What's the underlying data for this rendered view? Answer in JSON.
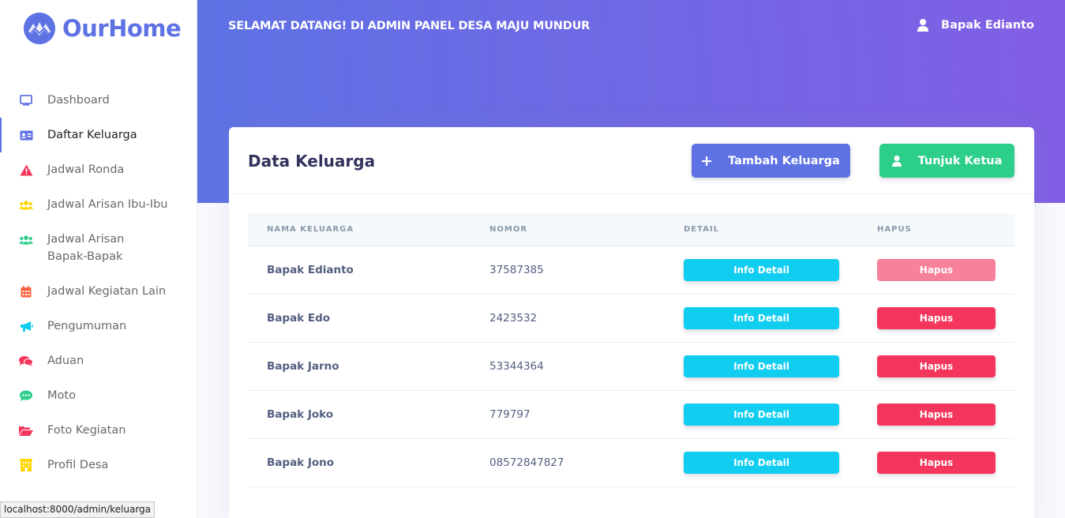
{
  "brand": {
    "name": "OurHome",
    "icon": "home-logo-icon",
    "color": "#5e72e4"
  },
  "sidebar": {
    "items": [
      {
        "label": "Dashboard",
        "icon": "tv-icon",
        "color": "#5e72e4",
        "active": false
      },
      {
        "label": "Daftar Keluarga",
        "icon": "id-card-icon",
        "color": "#5e72e4",
        "active": true
      },
      {
        "label": "Jadwal Ronda",
        "icon": "warning-icon",
        "color": "#f5365c",
        "active": false
      },
      {
        "label": "Jadwal Arisan Ibu-Ibu",
        "icon": "users-icon",
        "color": "#ffd600",
        "active": false
      },
      {
        "label": "Jadwal Arisan Bapak-Bapak",
        "icon": "users-icon",
        "color": "#2dce89",
        "active": false
      },
      {
        "label": "Jadwal Kegiatan Lain",
        "icon": "calendar-icon",
        "color": "#fb6340",
        "active": false
      },
      {
        "label": "Pengumuman",
        "icon": "megaphone-icon",
        "color": "#11cdef",
        "active": false
      },
      {
        "label": "Aduan",
        "icon": "comments-icon",
        "color": "#f5365c",
        "active": false
      },
      {
        "label": "Moto",
        "icon": "comment-dots-icon",
        "color": "#2dce89",
        "active": false
      },
      {
        "label": "Foto Kegiatan",
        "icon": "folder-open-icon",
        "color": "#f5365c",
        "active": false
      },
      {
        "label": "Profil Desa",
        "icon": "building-icon",
        "color": "#ffd600",
        "active": false
      }
    ]
  },
  "header": {
    "welcome": "SELAMAT DATANG! DI ADMIN PANEL DESA MAJU MUNDUR",
    "user_name": "Bapak Edianto"
  },
  "card": {
    "title": "Data Keluarga",
    "add_button": "Tambah Keluarga",
    "ketua_button": "Tunjuk Ketua"
  },
  "table": {
    "headers": [
      "NAMA KELUARGA",
      "NOMOR",
      "DETAIL",
      "HAPUS"
    ],
    "rows": [
      {
        "nama": "Bapak Edianto",
        "nomor": "37587385",
        "detail": "Info Detail",
        "hapus": "Hapus",
        "hapus_disabled": true
      },
      {
        "nama": "Bapak Edo",
        "nomor": "2423532",
        "detail": "Info Detail",
        "hapus": "Hapus",
        "hapus_disabled": false
      },
      {
        "nama": "Bapak Jarno",
        "nomor": "53344364",
        "detail": "Info Detail",
        "hapus": "Hapus",
        "hapus_disabled": false
      },
      {
        "nama": "Bapak Joko",
        "nomor": "779797",
        "detail": "Info Detail",
        "hapus": "Hapus",
        "hapus_disabled": false
      },
      {
        "nama": "Bapak Jono",
        "nomor": "08572847827",
        "detail": "Info Detail",
        "hapus": "Hapus",
        "hapus_disabled": false
      }
    ]
  },
  "status_bar": {
    "url": "localhost:8000/admin/keluarga"
  },
  "colors": {
    "primary": "#5e72e4",
    "success": "#2dce89",
    "info": "#11cdef",
    "danger": "#f5365c"
  }
}
